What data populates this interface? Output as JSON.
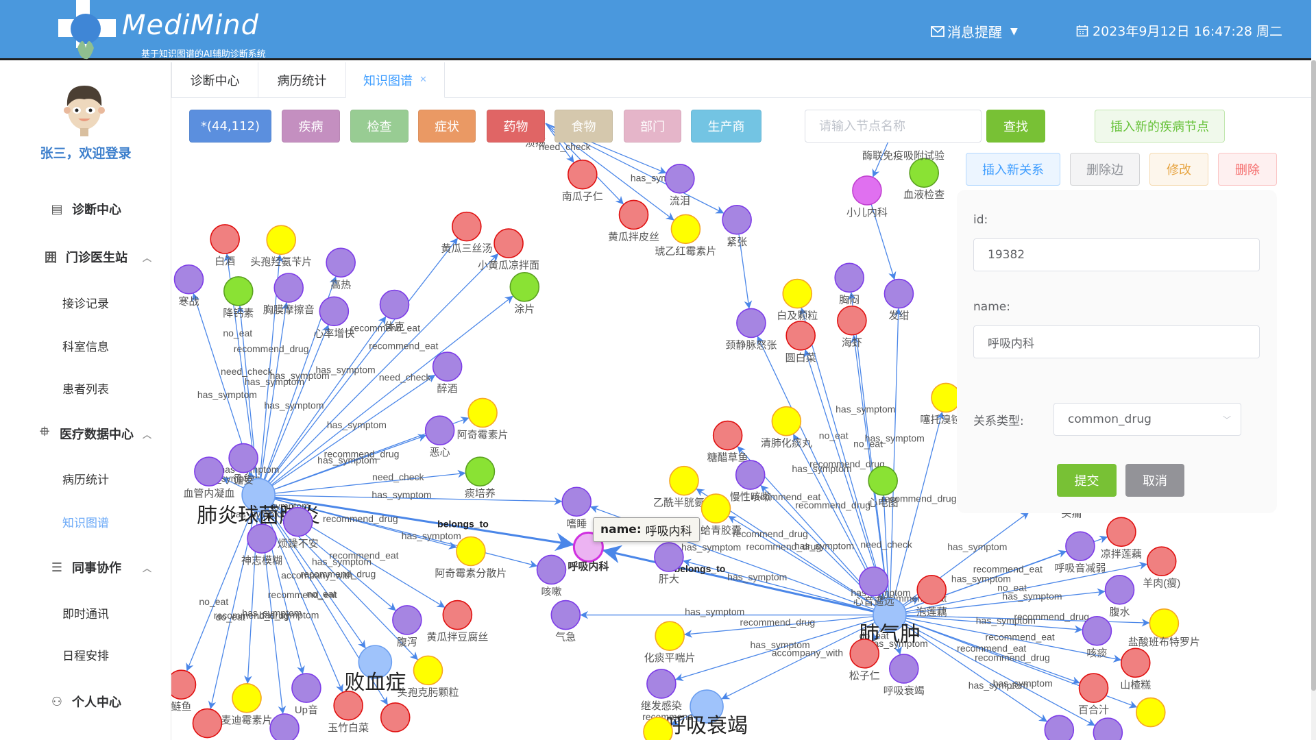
{
  "header": {
    "brand": "MediMind",
    "subtitle": "基于知识图谱的AI辅助诊断系统",
    "messages_label": "消息提醒",
    "datetime": "2023年9月12日 16:47:28 周二"
  },
  "sidebar": {
    "welcome": "张三，欢迎登录",
    "items": [
      {
        "label": "诊断中心",
        "type": "group",
        "icon": "clipboard-icon"
      },
      {
        "label": "门诊医生站",
        "type": "group",
        "icon": "building-icon",
        "expanded": true
      },
      {
        "label": "接诊记录",
        "type": "sub"
      },
      {
        "label": "科室信息",
        "type": "sub"
      },
      {
        "label": "患者列表",
        "type": "sub"
      },
      {
        "label": "医疗数据中心",
        "type": "group",
        "icon": "chip-icon",
        "expanded": true
      },
      {
        "label": "病历统计",
        "type": "sub"
      },
      {
        "label": "知识图谱",
        "type": "sub",
        "active": true
      },
      {
        "label": "同事协作",
        "type": "group",
        "icon": "chat-icon",
        "expanded": true
      },
      {
        "label": "即时通讯",
        "type": "sub"
      },
      {
        "label": "日程安排",
        "type": "sub"
      },
      {
        "label": "个人中心",
        "type": "group",
        "icon": "user-icon"
      }
    ]
  },
  "tabs": [
    {
      "label": "诊断中心"
    },
    {
      "label": "病历统计"
    },
    {
      "label": "知识图谱",
      "active": true,
      "closable": true
    }
  ],
  "toolbar": {
    "filters": [
      {
        "label": "*(44,112)",
        "color": "#5b8fde"
      },
      {
        "label": "疾病",
        "color": "#c48fc0"
      },
      {
        "label": "检查",
        "color": "#98cc93"
      },
      {
        "label": "症状",
        "color": "#ea9964"
      },
      {
        "label": "药物",
        "color": "#e06565"
      },
      {
        "label": "食物",
        "color": "#d5c8ad"
      },
      {
        "label": "部门",
        "color": "#e5b5c9"
      },
      {
        "label": "生产商",
        "color": "#73c4e3"
      }
    ],
    "search_placeholder": "请输入节点名称",
    "search_value": "",
    "search_button": "查找",
    "insert_disease_node": "插入新的疾病节点",
    "insert_relation": "插入新关系",
    "delete_edge": "删除边",
    "modify": "修改",
    "delete": "删除"
  },
  "form": {
    "id_label": "id:",
    "id_value": "19382",
    "name_label": "name:",
    "name_value": "呼吸内科",
    "relation_label": "关系类型:",
    "relation_value": "common_drug",
    "submit": "提交",
    "cancel": "取消"
  },
  "tooltip": {
    "key": "name:",
    "value": "呼吸内科"
  },
  "graph": {
    "category_colors": {
      "disease": {
        "fill": "#9fc3fb",
        "stroke": "#6a9ef0"
      },
      "symptom": {
        "fill": "#a685e2",
        "stroke": "#7d3ce8"
      },
      "food": {
        "fill": "#f08080",
        "stroke": "#e01010"
      },
      "drug": {
        "fill": "#ffff00",
        "stroke": "#f5a623"
      },
      "check": {
        "fill": "#8ae234",
        "stroke": "#5aa020"
      },
      "department": {
        "fill": "#e070f0",
        "stroke": "#c040d0"
      },
      "selected": {
        "fill": "#ecb3f2",
        "stroke": "#d030e0"
      },
      "edge": "#4a86e8"
    },
    "nodes": [
      {
        "id": "n0",
        "label": "肺炎球菌肺炎",
        "type": "disease",
        "hub": true
      },
      {
        "id": "n1",
        "label": "肺气肿",
        "type": "disease",
        "hub": true
      },
      {
        "id": "n2",
        "label": "败血症",
        "type": "disease",
        "hub": true
      },
      {
        "id": "n3",
        "label": "呼吸衰竭",
        "type": "disease",
        "hub": true
      },
      {
        "id": "n4",
        "label": "南瓜子仁",
        "type": "food"
      },
      {
        "id": "n5",
        "label": "流泪",
        "type": "symptom"
      },
      {
        "id": "n6",
        "label": "黄瓜拌皮丝",
        "type": "food"
      },
      {
        "id": "n7",
        "label": "琥乙红霉素片",
        "type": "drug"
      },
      {
        "id": "n8",
        "label": "紧张",
        "type": "symptom"
      },
      {
        "id": "n9",
        "label": "小儿内科",
        "type": "department"
      },
      {
        "id": "n10",
        "label": "血液检查",
        "type": "check"
      },
      {
        "id": "n11",
        "label": "黄瓜三丝汤",
        "type": "food"
      },
      {
        "id": "n12",
        "label": "小黄瓜凉拌面",
        "type": "food"
      },
      {
        "id": "n13",
        "label": "涂片",
        "type": "check"
      },
      {
        "id": "n14",
        "label": "白酒",
        "type": "food"
      },
      {
        "id": "n15",
        "label": "头孢羟氨苄片",
        "type": "drug"
      },
      {
        "id": "n16",
        "label": "高热",
        "type": "symptom"
      },
      {
        "id": "n17",
        "label": "寒战",
        "type": "symptom"
      },
      {
        "id": "n18",
        "label": "降钙素",
        "type": "check"
      },
      {
        "id": "n19",
        "label": "胸膜摩擦音",
        "type": "symptom"
      },
      {
        "id": "n20",
        "label": "心率增快",
        "type": "symptom"
      },
      {
        "id": "n21",
        "label": "休克",
        "type": "symptom"
      },
      {
        "id": "n22",
        "label": "醉酒",
        "type": "symptom"
      },
      {
        "id": "n23",
        "label": "阿奇霉素片",
        "type": "drug"
      },
      {
        "id": "n24",
        "label": "恶心",
        "type": "symptom"
      },
      {
        "id": "n25",
        "label": "痰培养",
        "type": "check"
      },
      {
        "id": "n26",
        "label": "谵妄",
        "type": "symptom"
      },
      {
        "id": "n27",
        "label": "血管内凝血",
        "type": "symptom"
      },
      {
        "id": "n28",
        "label": "烦躁不安",
        "type": "symptom"
      },
      {
        "id": "n29",
        "label": "神志模糊",
        "type": "symptom"
      },
      {
        "id": "n30",
        "label": "阿奇霉素分散片",
        "type": "drug"
      },
      {
        "id": "n31",
        "label": "嗜睡",
        "type": "symptom"
      },
      {
        "id": "n32",
        "label": "呼吸内科",
        "type": "selected",
        "bold": true
      },
      {
        "id": "n33",
        "label": "咳嗽",
        "type": "symptom"
      },
      {
        "id": "n34",
        "label": "肝大",
        "type": "symptom"
      },
      {
        "id": "n35",
        "label": "气急",
        "type": "symptom"
      },
      {
        "id": "n36",
        "label": "腹泻",
        "type": "symptom"
      },
      {
        "id": "n37",
        "label": "黄瓜拌豆腐丝",
        "type": "food"
      },
      {
        "id": "n38",
        "label": "头孢克肟颗粒",
        "type": "drug"
      },
      {
        "id": "n39",
        "label": "Up音",
        "type": "symptom"
      },
      {
        "id": "n40",
        "label": "麦迪霉素片",
        "type": "drug"
      },
      {
        "id": "n41",
        "label": "鲢鱼",
        "type": "food"
      },
      {
        "id": "n42",
        "label": "",
        "type": "food"
      },
      {
        "id": "n43",
        "label": "",
        "type": "symptom"
      },
      {
        "id": "n44",
        "label": "玉竹白菜",
        "type": "food"
      },
      {
        "id": "n45",
        "label": "",
        "type": "food"
      },
      {
        "id": "n46",
        "label": "颈静脉怒张",
        "type": "symptom"
      },
      {
        "id": "n47",
        "label": "白及颗粒",
        "type": "drug"
      },
      {
        "id": "n48",
        "label": "圆白菜",
        "type": "food"
      },
      {
        "id": "n49",
        "label": "胸闷",
        "type": "symptom"
      },
      {
        "id": "n50",
        "label": "海虾",
        "type": "food"
      },
      {
        "id": "n51",
        "label": "发绀",
        "type": "symptom"
      },
      {
        "id": "n52",
        "label": "噻托溴铵粉",
        "type": "drug"
      },
      {
        "id": "n53",
        "label": "清肺化痰丸",
        "type": "drug"
      },
      {
        "id": "n54",
        "label": "糖醋草鱼",
        "type": "food"
      },
      {
        "id": "n55",
        "label": "慢性咳嗽",
        "type": "symptom"
      },
      {
        "id": "n56",
        "label": "乙酰半胱氨酸",
        "type": "drug"
      },
      {
        "id": "n57",
        "label": "方蛤青胶囊",
        "type": "drug"
      },
      {
        "id": "n58",
        "label": "心电图",
        "type": "check"
      },
      {
        "id": "n59",
        "label": "心音遥远",
        "type": "symptom"
      },
      {
        "id": "n60",
        "label": "泡莲藕",
        "type": "food"
      },
      {
        "id": "n61",
        "label": "松子仁",
        "type": "food"
      },
      {
        "id": "n62",
        "label": "呼吸衰竭",
        "type": "symptom"
      },
      {
        "id": "n63",
        "label": "化痰平喘片",
        "type": "drug"
      },
      {
        "id": "n64",
        "label": "继发感染",
        "type": "symptom"
      },
      {
        "id": "n65",
        "label": "",
        "type": "drug"
      },
      {
        "id": "n66",
        "label": "凉拌莲藕",
        "type": "food"
      },
      {
        "id": "n67",
        "label": "呼吸音减弱",
        "type": "symptom"
      },
      {
        "id": "n68",
        "label": "羊肉(瘦)",
        "type": "food"
      },
      {
        "id": "n69",
        "label": "腹水",
        "type": "symptom"
      },
      {
        "id": "n70",
        "label": "盐酸班布特罗片",
        "type": "drug"
      },
      {
        "id": "n71",
        "label": "咳痰",
        "type": "symptom"
      },
      {
        "id": "n72",
        "label": "山楂糕",
        "type": "food"
      },
      {
        "id": "n73",
        "label": "百合汁",
        "type": "food"
      },
      {
        "id": "n74",
        "label": "",
        "type": "drug"
      },
      {
        "id": "n75",
        "label": "",
        "type": "symptom"
      },
      {
        "id": "n76",
        "label": "",
        "type": "symptom"
      },
      {
        "id": "n77",
        "label": "溃疡",
        "type": "symptom"
      },
      {
        "id": "n78",
        "label": "酶联免疫吸附试验",
        "type": "check"
      },
      {
        "id": "n79",
        "label": "头痛",
        "type": "symptom"
      }
    ],
    "edges": [
      {
        "from": "n0",
        "to": "n17",
        "label": "has_symptom"
      },
      {
        "from": "n0",
        "to": "n14",
        "label": "no_eat"
      },
      {
        "from": "n0",
        "to": "n18",
        "label": "need_check"
      },
      {
        "from": "n0",
        "to": "n15",
        "label": "recommend_drug"
      },
      {
        "from": "n0",
        "to": "n19",
        "label": "has_symptom"
      },
      {
        "from": "n0",
        "to": "n16",
        "label": "has_symptom"
      },
      {
        "from": "n0",
        "to": "n20",
        "label": "has_symptom"
      },
      {
        "from": "n0",
        "to": "n21",
        "label": "has_symptom"
      },
      {
        "from": "n0",
        "to": "n11",
        "label": "recommend_eat"
      },
      {
        "from": "n0",
        "to": "n12",
        "label": "recommend_eat"
      },
      {
        "from": "n0",
        "to": "n13",
        "label": "need_check"
      },
      {
        "from": "n0",
        "to": "n22",
        "label": "has_symptom"
      },
      {
        "from": "n0",
        "to": "n24",
        "label": "has_symptom"
      },
      {
        "from": "n0",
        "to": "n23",
        "label": "recommend_drug"
      },
      {
        "from": "n0",
        "to": "n25",
        "label": "need_check"
      },
      {
        "from": "n0",
        "to": "n26",
        "label": "has_symptom"
      },
      {
        "from": "n0",
        "to": "n27",
        "label": "has_symptom"
      },
      {
        "from": "n0",
        "to": "n28",
        "label": "has_symptom"
      },
      {
        "from": "n0",
        "to": "n29",
        "label": "has_symptom"
      },
      {
        "from": "n0",
        "to": "n30",
        "label": "recommend_drug"
      },
      {
        "from": "n0",
        "to": "n31",
        "label": "has_symptom"
      },
      {
        "from": "n0",
        "to": "n32",
        "label": "belongs_to",
        "bold": true
      },
      {
        "from": "n0",
        "to": "n33",
        "label": "has_symptom"
      },
      {
        "from": "n0",
        "to": "n36",
        "label": "has_symptom"
      },
      {
        "from": "n0",
        "to": "n37",
        "label": "recommend_eat"
      },
      {
        "from": "n0",
        "to": "n2",
        "label": "accompany_with"
      },
      {
        "from": "n0",
        "to": "n38",
        "label": "recommend_drug"
      },
      {
        "from": "n0",
        "to": "n39",
        "label": "has_symptom"
      },
      {
        "from": "n0",
        "to": "n40",
        "label": "recommend_drug"
      },
      {
        "from": "n0",
        "to": "n41",
        "label": "no_eat"
      },
      {
        "from": "n0",
        "to": "n42",
        "label": "do_eat"
      },
      {
        "from": "n0",
        "to": "n43",
        "label": "has_symptom"
      },
      {
        "from": "n0",
        "to": "n44",
        "label": "recommend_eat"
      },
      {
        "from": "n0",
        "to": "n45",
        "label": "no_eat"
      },
      {
        "from": "n1",
        "to": "n32",
        "label": "belongs_to",
        "bold": true
      },
      {
        "from": "n1",
        "to": "n34",
        "label": "has_symptom"
      },
      {
        "from": "n1",
        "to": "n31",
        "label": "has_symptom"
      },
      {
        "from": "n1",
        "to": "n35",
        "label": "has_symptom"
      },
      {
        "from": "n1",
        "to": "n63",
        "label": "recommend_drug"
      },
      {
        "from": "n1",
        "to": "n64",
        "label": "has_symptom"
      },
      {
        "from": "n1",
        "to": "n3",
        "label": "accompany_with"
      },
      {
        "from": "n1",
        "to": "n61",
        "label": "do_eat"
      },
      {
        "from": "n1",
        "to": "n62",
        "label": "has_symptom"
      },
      {
        "from": "n1",
        "to": "n59",
        "label": "has_symptom"
      },
      {
        "from": "n1",
        "to": "n60",
        "label": "recommend_eat"
      },
      {
        "from": "n1",
        "to": "n58",
        "label": "need_check"
      },
      {
        "from": "n1",
        "to": "n55",
        "label": "has_symptom"
      },
      {
        "from": "n1",
        "to": "n54",
        "label": "recommend_eat"
      },
      {
        "from": "n1",
        "to": "n57",
        "label": "recommend_drug"
      },
      {
        "from": "n1",
        "to": "n56",
        "label": "recommend_drug"
      },
      {
        "from": "n1",
        "to": "n53",
        "label": "recommend_drug"
      },
      {
        "from": "n1",
        "to": "n52",
        "label": "recommend_drug"
      },
      {
        "from": "n1",
        "to": "n46",
        "label": "has_symptom"
      },
      {
        "from": "n1",
        "to": "n47",
        "label": "recommend_drug"
      },
      {
        "from": "n1",
        "to": "n48",
        "label": "no_eat"
      },
      {
        "from": "n1",
        "to": "n49",
        "label": "has_symptom"
      },
      {
        "from": "n1",
        "to": "n50",
        "label": "no_eat"
      },
      {
        "from": "n1",
        "to": "n51",
        "label": "has_symptom"
      },
      {
        "from": "n1",
        "to": "n66",
        "label": "recommend_eat"
      },
      {
        "from": "n1",
        "to": "n67",
        "label": "has_symptom"
      },
      {
        "from": "n1",
        "to": "n68",
        "label": "no_eat"
      },
      {
        "from": "n1",
        "to": "n69",
        "label": "has_symptom"
      },
      {
        "from": "n1",
        "to": "n70",
        "label": "recommend_drug"
      },
      {
        "from": "n1",
        "to": "n71",
        "label": "has_symptom"
      },
      {
        "from": "n1",
        "to": "n72",
        "label": "recommend_eat"
      },
      {
        "from": "n1",
        "to": "n73",
        "label": "recommend_eat"
      },
      {
        "from": "n1",
        "to": "n74",
        "label": "recommend_drug"
      },
      {
        "from": "n1",
        "to": "n75",
        "label": "has_symptom"
      },
      {
        "from": "n1",
        "to": "n76",
        "label": "has_symptom"
      },
      {
        "from": "n1",
        "to": "n79",
        "label": "has_symptom"
      },
      {
        "from": "n3",
        "to": "n65",
        "label": "recommend_drug"
      },
      {
        "from": "n77",
        "to": "n4",
        "label": "need_check"
      },
      {
        "from": "n77",
        "to": "n6",
        "label": ""
      },
      {
        "from": "n77",
        "to": "n5",
        "label": ""
      },
      {
        "from": "n77",
        "to": "n7",
        "label": ""
      },
      {
        "from": "n77",
        "to": "n8",
        "label": "has_symptom"
      },
      {
        "from": "n78",
        "to": "n9",
        "label": ""
      },
      {
        "from": "n9",
        "to": "n51",
        "label": ""
      },
      {
        "from": "n8",
        "to": "n46",
        "label": ""
      }
    ]
  }
}
